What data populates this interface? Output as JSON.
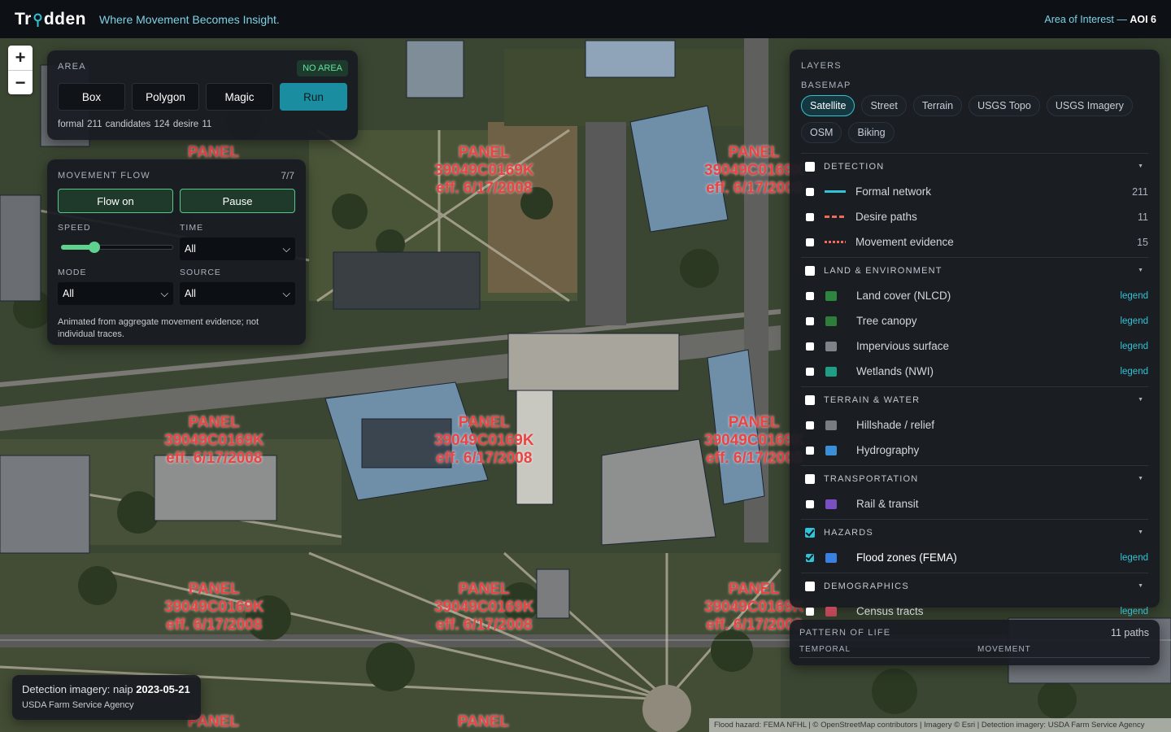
{
  "header": {
    "brand_prefix": "Tr",
    "brand_suffix": "dden",
    "tagline": "Where Movement Becomes Insight.",
    "aoi_label": "Area of Interest —",
    "aoi_value": "AOI 6"
  },
  "zoom": {
    "in": "+",
    "out": "−"
  },
  "area": {
    "label": "AREA",
    "badge": "NO AREA",
    "buttons": [
      "Box",
      "Polygon",
      "Magic"
    ],
    "run": "Run",
    "counts": "formal 211   candidates 124   desire 11"
  },
  "flow": {
    "label": "MOVEMENT FLOW",
    "count": "7/7",
    "flow_on": "Flow on",
    "pause": "Pause",
    "speed_label": "SPEED",
    "speed_fraction": 0.3,
    "time_label": "TIME",
    "time_value": "All",
    "mode_label": "MODE",
    "mode_value": "All",
    "source_label": "SOURCE",
    "source_value": "All",
    "note": "Animated from aggregate movement evidence; not individual traces."
  },
  "layers": {
    "title": "LAYERS",
    "basemap_label": "BASEMAP",
    "basemaps": [
      "Satellite",
      "Street",
      "Terrain",
      "USGS Topo",
      "USGS Imagery",
      "OSM",
      "Biking"
    ],
    "basemap_selected": "Satellite",
    "legend_link": "legend",
    "groups": {
      "detection": {
        "name": "DETECTION",
        "formal": {
          "name": "Formal network",
          "count": "211",
          "color": "#33c3d6"
        },
        "desire": {
          "name": "Desire paths",
          "count": "11",
          "color": "#ef6a5a"
        },
        "evidence": {
          "name": "Movement evidence",
          "count": "15",
          "color": "#ef6a5a"
        }
      },
      "land": {
        "name": "LAND & ENVIRONMENT",
        "nlcd": {
          "name": "Land cover (NLCD)",
          "color": "#2e8540"
        },
        "canopy": {
          "name": "Tree canopy",
          "color": "#2e7d3a"
        },
        "impervious": {
          "name": "Impervious surface",
          "color": "#7f8389"
        },
        "wetlands": {
          "name": "Wetlands (NWI)",
          "color": "#1f9e86"
        }
      },
      "terrain": {
        "name": "TERRAIN & WATER",
        "hillshade": {
          "name": "Hillshade / relief",
          "color": "#7a7d80"
        },
        "hydro": {
          "name": "Hydrography",
          "color": "#3b8fd6"
        }
      },
      "transport": {
        "name": "TRANSPORTATION",
        "rail": {
          "name": "Rail & transit",
          "color": "#7a4fc2"
        }
      },
      "hazards": {
        "name": "HAZARDS",
        "flood": {
          "name": "Flood zones (FEMA)",
          "color": "#3b7fe0"
        }
      },
      "demographics": {
        "name": "DEMOGRAPHICS",
        "census": {
          "name": "Census tracts",
          "color": "#c0485a"
        }
      }
    }
  },
  "pattern": {
    "label": "PATTERN OF LIFE",
    "count": "11 paths",
    "temporal": "TEMPORAL",
    "movement": "MOVEMENT"
  },
  "imagery": {
    "prefix": "Detection imagery: naip",
    "date": "2023-05-21",
    "agency": "USDA Farm Service Agency"
  },
  "map_labels": {
    "panel": "PANEL",
    "panel_id": "39049C0169K",
    "effective": "eff. 6/17/2008"
  },
  "attribution": "Flood hazard: FEMA NFHL | © OpenStreetMap contributors | Imagery © Esri | Detection imagery: USDA Farm Service Agency"
}
